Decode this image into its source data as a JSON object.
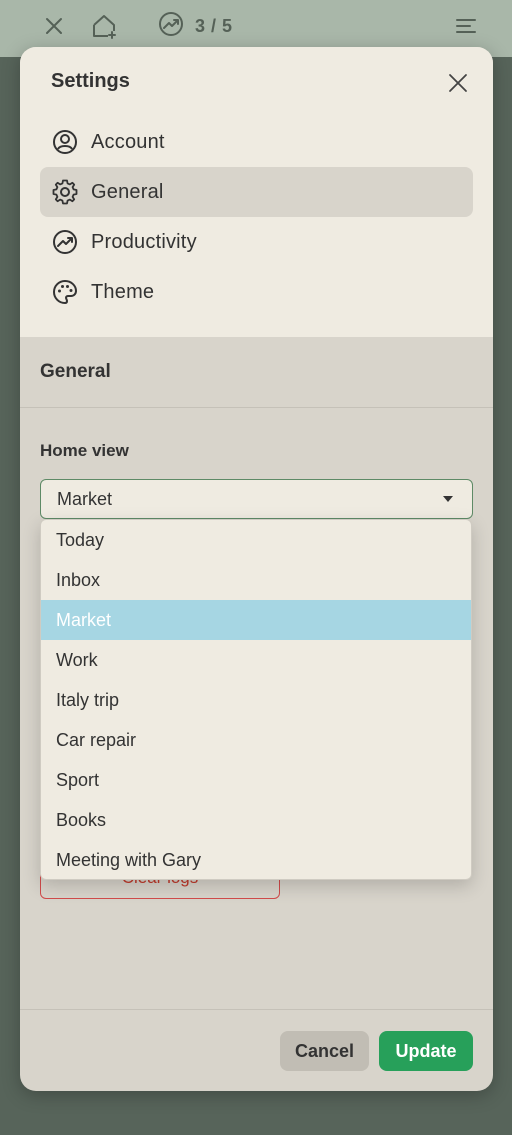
{
  "topbar": {
    "close_icon": "close-icon",
    "home_add_icon": "home-add-icon",
    "progress_icon": "trending-icon",
    "progress_count": "3 / 5",
    "menu_icon": "menu-icon"
  },
  "modal": {
    "title": "Settings",
    "nav": [
      {
        "label": "Account",
        "icon": "account-circle-icon",
        "active": false
      },
      {
        "label": "General",
        "icon": "gear-icon",
        "active": true
      },
      {
        "label": "Productivity",
        "icon": "trending-icon",
        "active": false
      },
      {
        "label": "Theme",
        "icon": "palette-icon",
        "active": false
      }
    ],
    "section_title": "General",
    "home_view": {
      "label": "Home view",
      "value": "Market",
      "options": [
        "Today",
        "Inbox",
        "Market",
        "Work",
        "Italy trip",
        "Car repair",
        "Sport",
        "Books",
        "Meeting with Gary"
      ],
      "selected_index": 2
    },
    "clear_logs_label": "Clear logs",
    "cancel_label": "Cancel",
    "update_label": "Update"
  },
  "colors": {
    "accent_green": "#27a05a",
    "selected_option": "#a6d6e3",
    "danger": "#d14b4b"
  }
}
